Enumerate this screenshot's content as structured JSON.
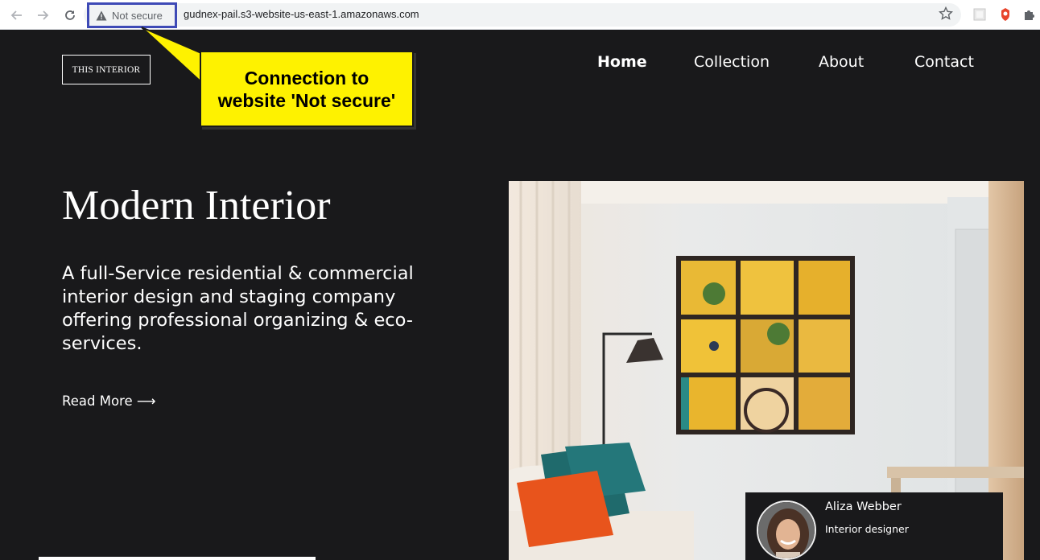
{
  "browser": {
    "security_label": "Not secure",
    "url": "gudnex-pail.s3-website-us-east-1.amazonaws.com",
    "icons": [
      "back-arrow-icon",
      "forward-arrow-icon",
      "reload-icon",
      "warning-icon",
      "star-icon",
      "extension-icon",
      "puzzle-icon"
    ]
  },
  "annotation": {
    "callout_line1": "Connection to",
    "callout_line2": "website 'Not secure'",
    "box_color": "#3e4ab6",
    "callout_color": "#fef200"
  },
  "site": {
    "logo": "THIS INTERIOR",
    "nav": [
      "Home",
      "Collection",
      "About",
      "Contact"
    ],
    "active_nav": "Home",
    "hero_title": "Modern Interior",
    "hero_text": "A full-Service residential & commercial interior design and staging company offering professional organizing & eco-services.",
    "read_more": "Read More ⟶",
    "profile": {
      "name": "Aliza Webber",
      "role": "Interior designer"
    },
    "background_color": "#19191b"
  }
}
